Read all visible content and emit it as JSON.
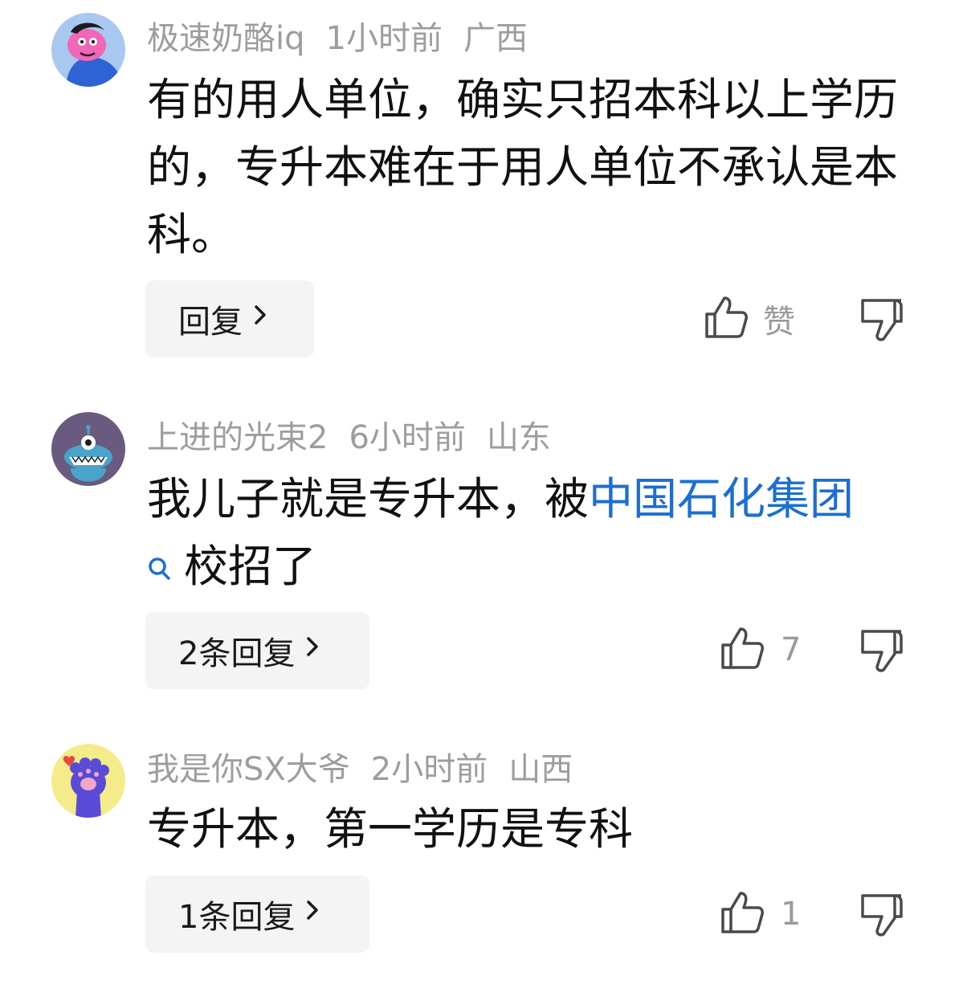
{
  "comments": [
    {
      "username": "极速奶酪iq",
      "time": "1小时前",
      "location": "广西",
      "text": "有的用人单位，确实只招本科以上学历的，专升本难在于用人单位不承认是本科。",
      "reply_label": "回复",
      "like_label": "赞",
      "avatar": "pink-character-avatar"
    },
    {
      "username": "上进的光束2",
      "time": "6小时前",
      "location": "山东",
      "text_before": "我儿子就是专升本，被",
      "link_text": "中国石化集团",
      "text_after": "校招了",
      "reply_label": "2条回复",
      "like_label": "7",
      "avatar": "blue-monster-avatar"
    },
    {
      "username": "我是你SX大爷",
      "time": "2小时前",
      "location": "山西",
      "text": "专升本，第一学历是专科",
      "reply_label": "1条回复",
      "like_label": "1",
      "avatar": "purple-paw-avatar"
    }
  ],
  "icons": {
    "like": "thumbs-up-icon",
    "dislike": "thumbs-down-icon",
    "chevron": "chevron-right-icon",
    "search": "search-icon"
  },
  "colors": {
    "meta": "#9d9d9d",
    "link": "#1a6fd1",
    "button_bg": "#f4f4f4"
  }
}
